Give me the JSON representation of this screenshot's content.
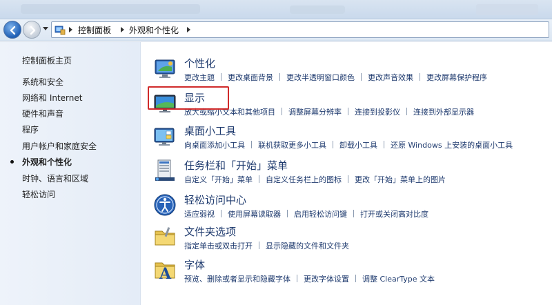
{
  "address": {
    "crumbs": [
      "控制面板",
      "外观和个性化"
    ]
  },
  "sidebar": {
    "home": "控制面板主页",
    "items": [
      {
        "label": "系统和安全"
      },
      {
        "label": "网络和 Internet"
      },
      {
        "label": "硬件和声音"
      },
      {
        "label": "程序"
      },
      {
        "label": "用户帐户和家庭安全"
      },
      {
        "label": "外观和个性化",
        "current": true
      },
      {
        "label": "时钟、语言和区域"
      },
      {
        "label": "轻松访问"
      }
    ]
  },
  "categories": [
    {
      "title": "个性化",
      "icon": "personalization-icon",
      "links": [
        "更改主题",
        "更改桌面背景",
        "更改半透明窗口颜色",
        "更改声音效果",
        "更改屏幕保护程序"
      ]
    },
    {
      "title": "显示",
      "icon": "display-icon",
      "links": [
        "放大或缩小文本和其他项目",
        "调整屏幕分辨率",
        "连接到投影仪",
        "连接到外部显示器"
      ]
    },
    {
      "title": "桌面小工具",
      "icon": "gadgets-icon",
      "links": [
        "向桌面添加小工具",
        "联机获取更多小工具",
        "卸载小工具",
        "还原 Windows 上安装的桌面小工具"
      ]
    },
    {
      "title": "任务栏和「开始」菜单",
      "icon": "taskbar-icon",
      "links": [
        "自定义「开始」菜单",
        "自定义任务栏上的图标",
        "更改「开始」菜单上的图片"
      ]
    },
    {
      "title": "轻松访问中心",
      "icon": "ease-of-access-icon",
      "links": [
        "适应弱视",
        "使用屏幕读取器",
        "启用轻松访问键",
        "打开或关闭高对比度"
      ]
    },
    {
      "title": "文件夹选项",
      "icon": "folder-options-icon",
      "links": [
        "指定单击或双击打开",
        "显示隐藏的文件和文件夹"
      ]
    },
    {
      "title": "字体",
      "icon": "fonts-icon",
      "links": [
        "预览、删除或者显示和隐藏字体",
        "更改字体设置",
        "调整 ClearType 文本"
      ]
    }
  ],
  "colors": {
    "link": "#1e3a6e",
    "highlight_box": "#d02a2a"
  }
}
